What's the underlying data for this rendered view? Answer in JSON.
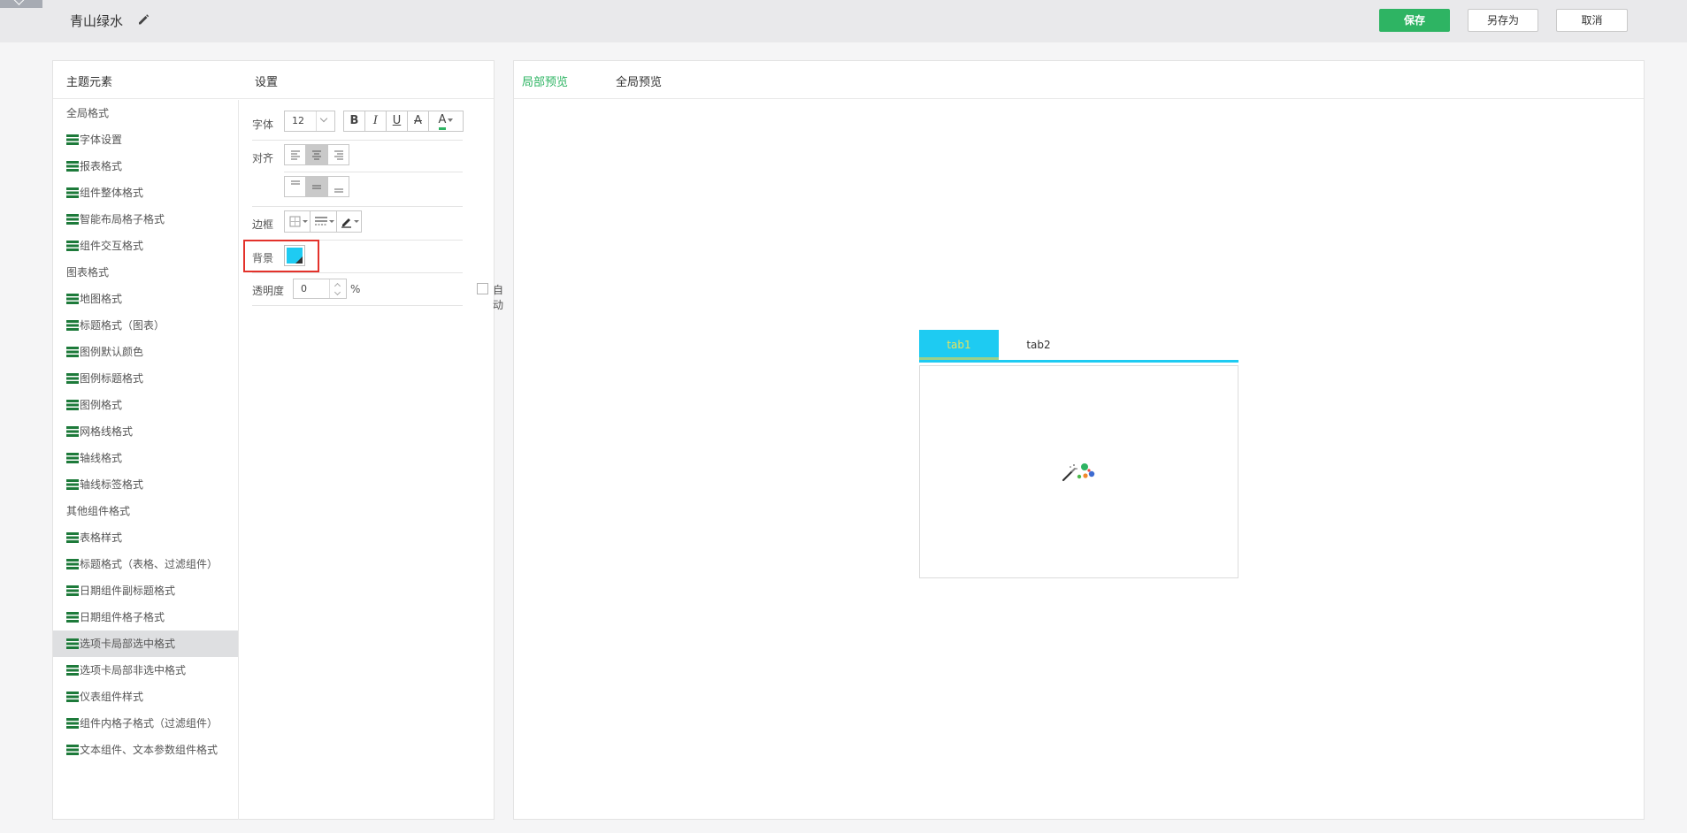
{
  "header": {
    "theme_name": "青山绿水",
    "edit_icon": "pencil-icon",
    "save_label": "保存",
    "save_as_label": "另存为",
    "cancel_label": "取消"
  },
  "left_panel": {
    "elements_header": "主题元素",
    "settings_header": "设置",
    "tree": [
      {
        "label": "全局格式",
        "type": "group"
      },
      {
        "label": "字体设置",
        "type": "item"
      },
      {
        "label": "报表格式",
        "type": "item"
      },
      {
        "label": "组件整体格式",
        "type": "item"
      },
      {
        "label": "智能布局格子格式",
        "type": "item"
      },
      {
        "label": "组件交互格式",
        "type": "item"
      },
      {
        "label": "图表格式",
        "type": "group"
      },
      {
        "label": "地图格式",
        "type": "item"
      },
      {
        "label": "标题格式（图表）",
        "type": "item"
      },
      {
        "label": "图例默认颜色",
        "type": "item"
      },
      {
        "label": "图例标题格式",
        "type": "item"
      },
      {
        "label": "图例格式",
        "type": "item"
      },
      {
        "label": "网格线格式",
        "type": "item"
      },
      {
        "label": "轴线格式",
        "type": "item"
      },
      {
        "label": "轴线标签格式",
        "type": "item"
      },
      {
        "label": "其他组件格式",
        "type": "group"
      },
      {
        "label": "表格样式",
        "type": "item"
      },
      {
        "label": "标题格式（表格、过滤组件）",
        "type": "item"
      },
      {
        "label": "日期组件副标题格式",
        "type": "item"
      },
      {
        "label": "日期组件格子格式",
        "type": "item"
      },
      {
        "label": "选项卡局部选中格式",
        "type": "item",
        "selected": true
      },
      {
        "label": "选项卡局部非选中格式",
        "type": "item"
      },
      {
        "label": "仪表组件样式",
        "type": "item"
      },
      {
        "label": "组件内格子格式（过滤组件）",
        "type": "item"
      },
      {
        "label": "文本组件、文本参数组件格式",
        "type": "item"
      }
    ]
  },
  "settings": {
    "font_label": "字体",
    "font_size": "12",
    "bold": "B",
    "italic": "I",
    "underline": "U",
    "strike": "A",
    "font_color_glyph": "A",
    "align_label": "对齐",
    "border_label": "边框",
    "background_label": "背景",
    "background_color": "#1ecbf2",
    "opacity_label": "透明度",
    "opacity_value": "0",
    "percent": "%",
    "auto_label": "自动"
  },
  "right_panel": {
    "tab_local": "局部预览",
    "tab_global": "全局预览",
    "preview_tabs": [
      "tab1",
      "tab2"
    ],
    "selected_tab_bg": "#1ecbf2",
    "selected_tab_text": "#e8e35a"
  },
  "colors": {
    "accent_green": "#2eb463",
    "highlight_red": "#e3322b"
  }
}
